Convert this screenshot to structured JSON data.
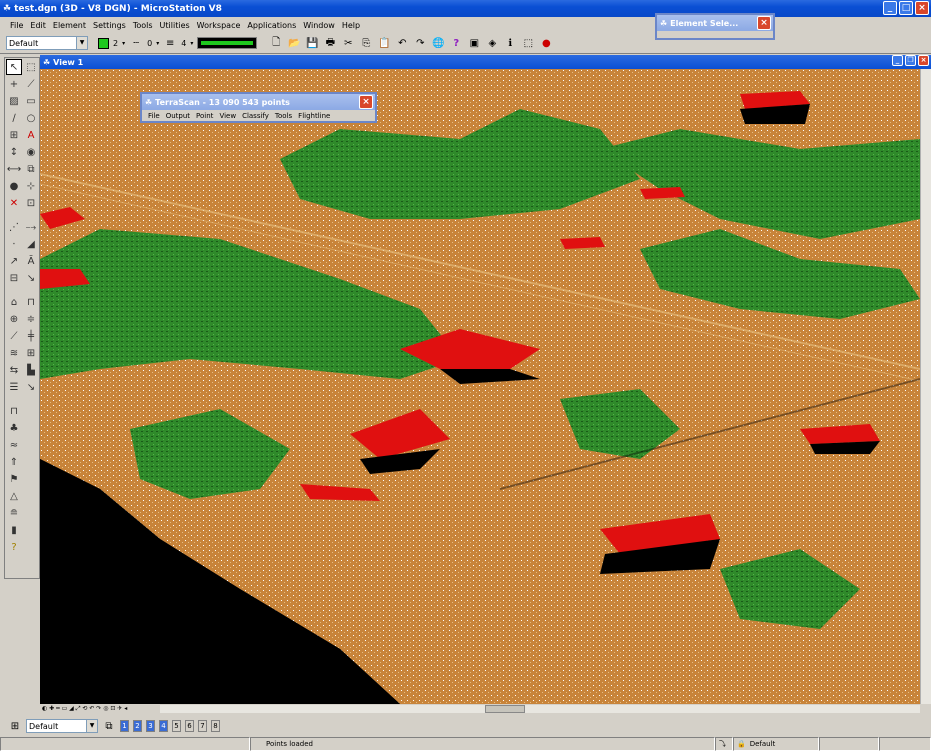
{
  "app": {
    "title": "test.dgn (3D - V8 DGN) - MicroStation V8"
  },
  "menu": [
    "File",
    "Edit",
    "Element",
    "Settings",
    "Tools",
    "Utilities",
    "Workspace",
    "Applications",
    "Window",
    "Help"
  ],
  "toolbar": {
    "level": "Default",
    "color_index": "2",
    "style_index": "0",
    "weight_index": "4"
  },
  "element_selection": {
    "title": "Element Sele..."
  },
  "view": {
    "title": "View 1"
  },
  "terrascan": {
    "title": "TerraScan - 13 090 543 points",
    "menu": [
      "File",
      "Output",
      "Point",
      "View",
      "Classify",
      "Tools",
      "Flightline"
    ]
  },
  "bottom": {
    "level": "Default",
    "views": [
      "1",
      "2",
      "3",
      "4",
      "5",
      "6",
      "7",
      "8"
    ],
    "active_views": [
      "1",
      "2",
      "3",
      "4"
    ]
  },
  "status": {
    "message": "Points loaded",
    "level": "Default"
  },
  "colors": {
    "ground": "#c8843a",
    "vegetation": "#2f8a2a",
    "building": "#e01010",
    "background": "#000000"
  }
}
